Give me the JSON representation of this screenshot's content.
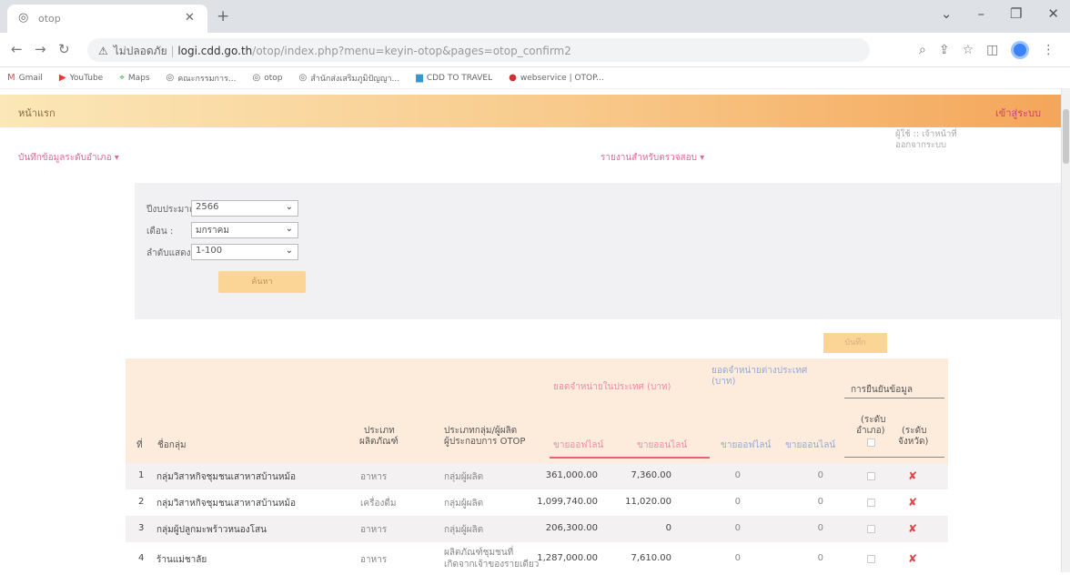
{
  "browser": {
    "tab_title": "otop",
    "favicon": "globe-icon",
    "url_warning": "ไม่ปลอดภัย",
    "url_host": "logi.cdd.go.th",
    "url_path": "/otop/index.php?menu=keyin-otop&pages=otop_confirm2",
    "bookmarks": [
      "Gmail",
      "YouTube",
      "Maps",
      "คณะกรรมการ...",
      "otop",
      "สำนักส่งเสริมภูมิปัญญา...",
      "CDD TO TRAVEL",
      "webservice | OTOP..."
    ]
  },
  "header": {
    "home": "หน้าแรก",
    "login": "เข้าสู่ระบบ",
    "menu_left": "บันทึกข้อมูลระดับอำเภอ ▾",
    "menu_mid": "รายงานสำหรับตรวจสอบ ▾",
    "user_line1": "ผู้ใช้ :: เจ้าหน้าที่",
    "user_line2": "ออกจากระบบ"
  },
  "filter": {
    "year_label": "ปีงบประมาณ :",
    "year_value": "2566",
    "month_label": "เดือน :",
    "month_value": "มกราคม",
    "order_label": "ลำดับแสดงข้อมูล",
    "order_value": "1-100",
    "search_label": "ค้นหา"
  },
  "save_label": "บันทึก",
  "table": {
    "col_no": "ที่",
    "col_group": "ชื่อกลุ่ม",
    "col_type_1": "ประเภท",
    "col_type_2": "ผลิตภัณฑ์",
    "col_entre_1": "ประเภทกลุ่ม/ผู้ผลิต",
    "col_entre_2": "ผู้ประกอบการ OTOP",
    "sales_in_country": "ยอดจำหน่ายในประเทศ (บาท)",
    "sales_abroad_1": "ยอดจำหน่ายต่างประเทศ",
    "sales_abroad_2": "(บาท)",
    "offline": "ขายออฟไลน์",
    "online": "ขายออนไลน์",
    "confirm_header": "การยืนยันข้อมูล",
    "confirm_amphoe_1": "(ระดับ",
    "confirm_amphoe_2": "อำเภอ)",
    "confirm_province_1": "(ระดับ",
    "confirm_province_2": "จังหวัด)",
    "rows": [
      {
        "no": "1",
        "name": "กลุ่มวิสาหกิจชุมชนเสาหาสบ้านหม้อ",
        "type": "อาหาร",
        "entre": "กลุ่มผู้ผลิต",
        "offline": "361,000.00",
        "online": "7,360.00",
        "abroad_off": "0",
        "abroad_on": "0"
      },
      {
        "no": "2",
        "name": "กลุ่มวิสาหกิจชุมชนเสาหาสบ้านหม้อ",
        "type": "เครื่องดื่ม",
        "entre": "กลุ่มผู้ผลิต",
        "offline": "1,099,740.00",
        "online": "11,020.00",
        "abroad_off": "0",
        "abroad_on": "0"
      },
      {
        "no": "3",
        "name": "กลุ่มผู้ปลูกมะพร้าวหนองโสน",
        "type": "อาหาร",
        "entre": "กลุ่มผู้ผลิต",
        "offline": "206,300.00",
        "online": "0",
        "abroad_off": "0",
        "abroad_on": "0"
      },
      {
        "no": "4",
        "name": "ร้านแม่ชาลัย",
        "type": "อาหาร",
        "entre_1": "ผลิตภัณฑ์ชุมชนที่",
        "entre_2": "เกิดจากเจ้าของรายเดียว",
        "offline": "1,287,000.00",
        "online": "7,610.00",
        "abroad_off": "0",
        "abroad_on": "0"
      }
    ]
  },
  "colors": {
    "accent": "#f4a65a",
    "pink": "#f28aa6",
    "reject": "#e0434a"
  }
}
